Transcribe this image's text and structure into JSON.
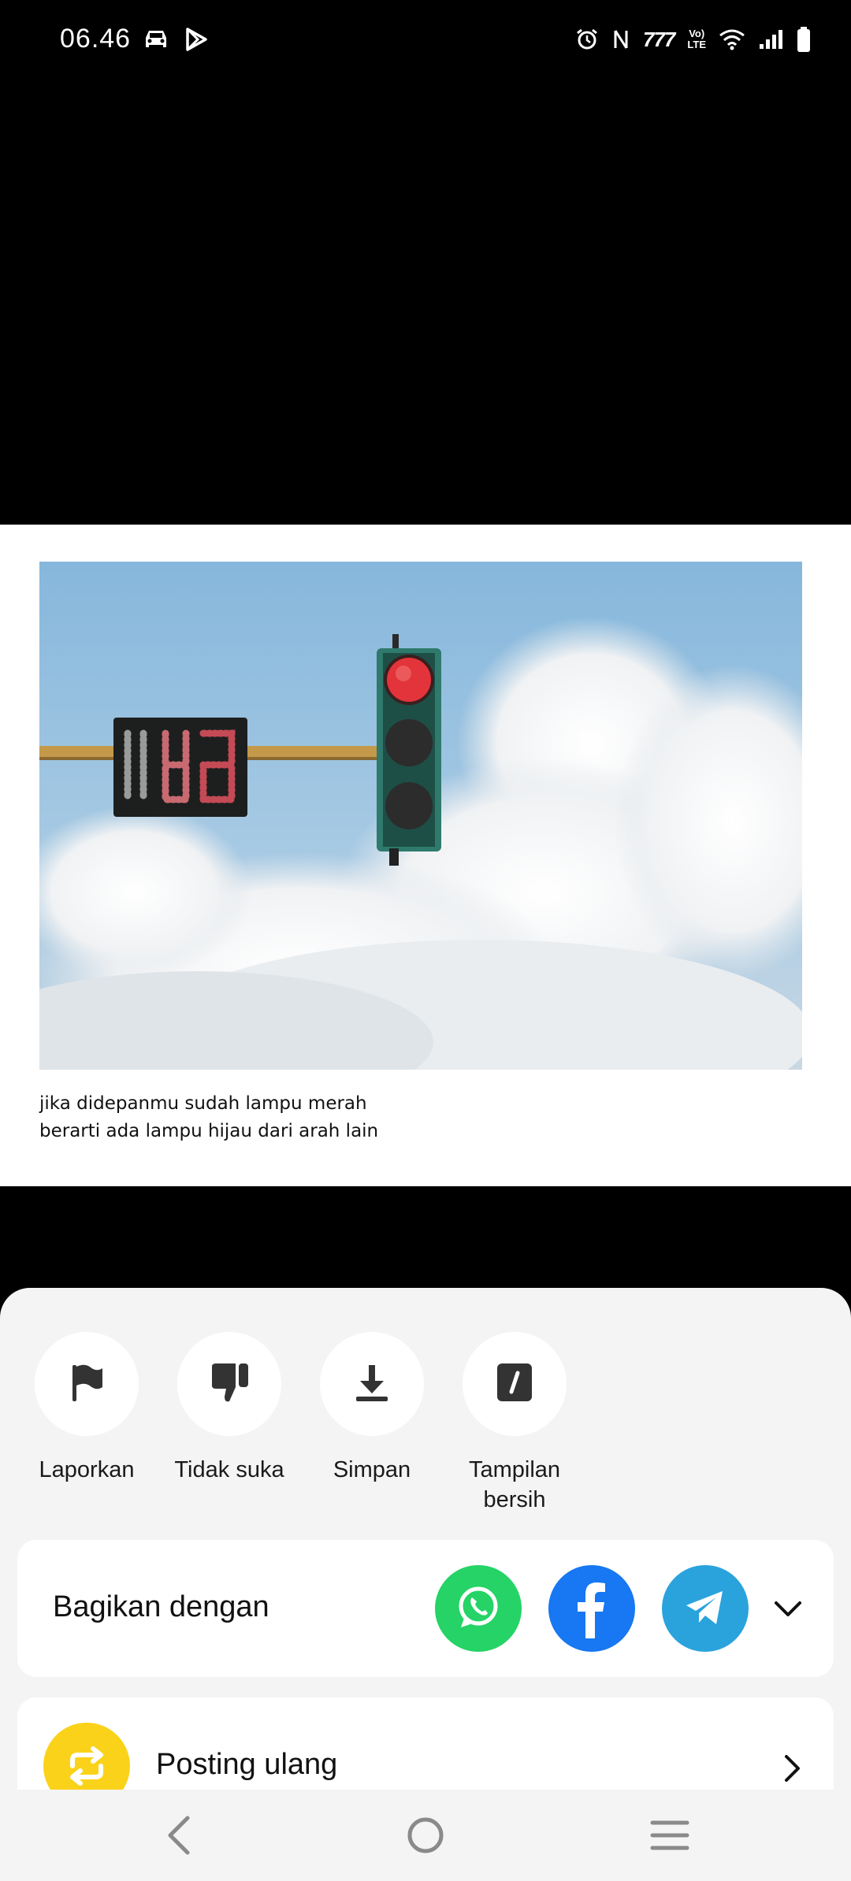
{
  "status_bar": {
    "time": "06.46",
    "network_label": "777",
    "volte_top": "Vo)",
    "volte_bottom": "LTE",
    "icons_left": [
      "car-icon",
      "play-store-icon"
    ],
    "icons_right": [
      "alarm-icon",
      "nfc-icon",
      "network-icon",
      "volte-icon",
      "wifi-icon",
      "signal-icon",
      "battery-icon"
    ]
  },
  "post": {
    "image_alt": "traffic-light-photo",
    "caption_line1": "jika didepanmu sudah lampu merah",
    "caption_line2": "berarti ada lampu hijau dari arah lain"
  },
  "actions": [
    {
      "label": "Laporkan",
      "icon": "flag-icon"
    },
    {
      "label": "Tidak suka",
      "icon": "thumbs-down-icon"
    },
    {
      "label": "Simpan",
      "icon": "download-icon"
    },
    {
      "label": "Tampilan bersih",
      "icon": "clear-display-icon"
    }
  ],
  "share": {
    "title": "Bagikan dengan",
    "apps": [
      {
        "name": "WhatsApp",
        "icon": "whatsapp-icon",
        "color": "#25d366"
      },
      {
        "name": "Facebook",
        "icon": "facebook-icon",
        "color": "#1877f2"
      },
      {
        "name": "Telegram",
        "icon": "telegram-icon",
        "color": "#2aa3dd"
      }
    ]
  },
  "repost": {
    "label": "Posting ulang",
    "color": "#fbd21a"
  },
  "nav": [
    "back-icon",
    "home-icon",
    "recents-icon"
  ]
}
